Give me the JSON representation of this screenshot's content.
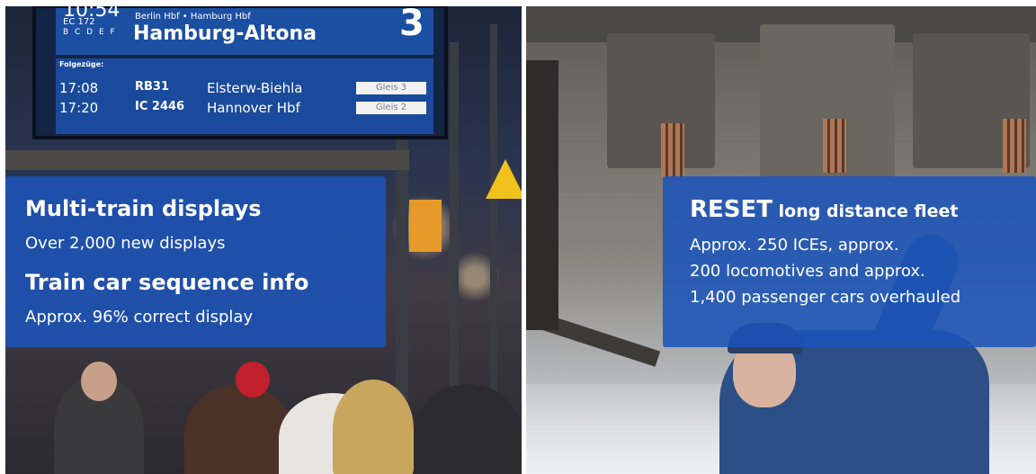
{
  "station_board": {
    "time": "10:54",
    "train": "EC 172",
    "cars": "B C D E F",
    "route": "Berlin Hbf • Hamburg Hbf",
    "destination": "Hamburg-Altona",
    "platform": "3",
    "following_label": "Folgezüge:",
    "departures": [
      {
        "time": "17:08",
        "line": "RB31",
        "destination": "Elsterw-Biehla",
        "platform": "Gleis 3"
      },
      {
        "time": "17:20",
        "line": "IC 2446",
        "destination": "Hannover Hbf",
        "platform": "Gleis 2"
      }
    ]
  },
  "left_overlay": {
    "heading1": "Multi-train displays",
    "text1": "Over 2,000 new displays",
    "heading2": "Train car sequence info",
    "text2": "Approx. 96% correct display"
  },
  "right_overlay": {
    "heading_strong": "RESET",
    "heading_rest": " long distance fleet",
    "lines": [
      "Approx. 250 ICEs, approx.",
      "200 locomotives and approx.",
      "1,400 passenger cars overhauled"
    ]
  },
  "colors": {
    "overlay_blue": "#1b54ba",
    "board_blue": "#1b4fa2",
    "divider": "#ffffff"
  }
}
